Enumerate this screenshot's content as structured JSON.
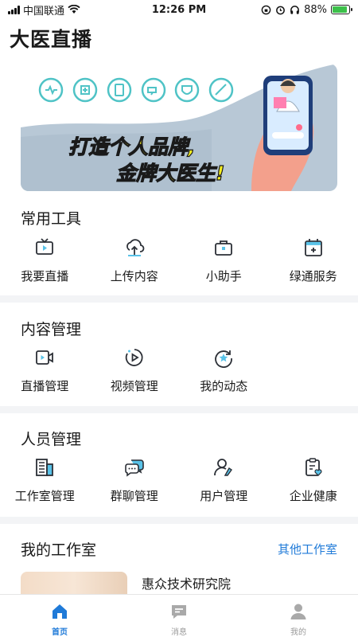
{
  "status_bar": {
    "carrier": "中国联通",
    "time": "12:26 PM",
    "battery": "88%",
    "battery_level": 0.88
  },
  "header": {
    "title": "大医直播"
  },
  "banner": {
    "line1": "打造个人品牌,",
    "line2": "金牌大医生!",
    "colors": {
      "background": "#b8c8d6",
      "headline": "#f6ef1f",
      "hand": "#f3a08c",
      "accent": "#4fc3c6"
    }
  },
  "sections": {
    "common_tools": {
      "title": "常用工具",
      "items": [
        {
          "label": "我要直播",
          "icon": "live-tv-icon"
        },
        {
          "label": "上传内容",
          "icon": "cloud-upload-icon"
        },
        {
          "label": "小助手",
          "icon": "briefcase-icon"
        },
        {
          "label": "绿通服务",
          "icon": "calendar-plus-icon"
        }
      ]
    },
    "content_mgmt": {
      "title": "内容管理",
      "items": [
        {
          "label": "直播管理",
          "icon": "video-camera-icon"
        },
        {
          "label": "视频管理",
          "icon": "play-circle-icon"
        },
        {
          "label": "我的动态",
          "icon": "star-refresh-icon"
        }
      ]
    },
    "people_mgmt": {
      "title": "人员管理",
      "items": [
        {
          "label": "工作室管理",
          "icon": "building-icon"
        },
        {
          "label": "群聊管理",
          "icon": "chat-bubbles-icon"
        },
        {
          "label": "用户管理",
          "icon": "user-edit-icon"
        },
        {
          "label": "企业健康",
          "icon": "clipboard-heart-icon"
        }
      ]
    },
    "my_studio": {
      "title": "我的工作室",
      "link": "其他工作室",
      "studio_name": "惠众技术研究院"
    }
  },
  "tab_bar": {
    "tabs": [
      {
        "label": "首页",
        "icon": "home-icon",
        "active": true
      },
      {
        "label": "消息",
        "icon": "message-icon",
        "active": false
      },
      {
        "label": "我的",
        "icon": "person-icon",
        "active": false
      }
    ]
  },
  "colors": {
    "accent": "#1f7ad8",
    "icon_stroke": "#2b2f36",
    "icon_fill": "#59c2e8"
  }
}
